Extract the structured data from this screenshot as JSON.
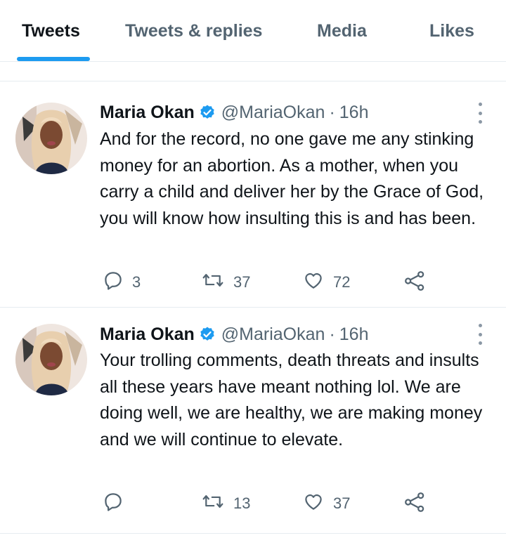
{
  "tabs": [
    {
      "label": "Tweets",
      "active": true
    },
    {
      "label": "Tweets & replies",
      "active": false
    },
    {
      "label": "Media",
      "active": false
    },
    {
      "label": "Likes",
      "active": false
    }
  ],
  "accent_color": "#1d9bf0",
  "tweets": [
    {
      "name": "Maria Okan",
      "handle": "@MariaOkan",
      "separator": "·",
      "time": "16h",
      "text": "And for the record, no one gave me any stinking money for an abortion. As a mother, when you carry a child and deliver her by the Grace of God, you will know how insulting this is and has been.",
      "reply_count": "3",
      "retweet_count": "37",
      "like_count": "72",
      "icons": [
        "reply-icon",
        "retweet-icon",
        "like-icon",
        "share-icon"
      ]
    },
    {
      "name": "Maria Okan",
      "handle": "@MariaOkan",
      "separator": "·",
      "time": "16h",
      "text": "Your trolling comments, death threats and insults all these years have meant nothing lol. We are doing well, we are healthy, we are making money and we will continue to elevate.",
      "reply_count": "",
      "retweet_count": "13",
      "like_count": "37",
      "icons": [
        "reply-icon",
        "retweet-icon",
        "like-icon",
        "share-icon"
      ]
    }
  ]
}
